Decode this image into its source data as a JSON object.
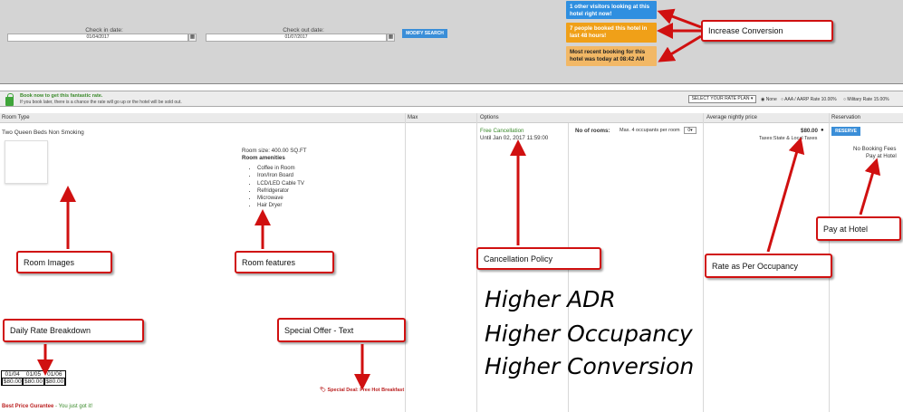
{
  "search": {
    "checkin_label": "Check in date:",
    "checkin_value": "01/04/2017",
    "checkout_label": "Check out date:",
    "checkout_value": "01/07/2017",
    "calendar_icon": "calendar-icon",
    "modify_label": "MODIFY SEARCH"
  },
  "notices": {
    "visitors": "1 other visitors looking at this hotel right now!",
    "booked": "7 people booked this hotel in last 48 hours!",
    "recent": "Most recent booking for this hotel was today at 08:42 AM"
  },
  "promo": {
    "title": "Book now to get this fantastic rate.",
    "subtitle": "If you book later, there is a chance the rate will go up or the hotel will be sold out.",
    "rate_plan_label": "SELECT YOUR RATE PLAN",
    "option_none": "None",
    "option_aaa": "AAA / AARP Rate 10.00%",
    "option_military": "Military Rate 15.00%"
  },
  "table": {
    "headers": {
      "room_type": "Room Type",
      "max": "Max",
      "options": "Options",
      "avg_price": "Average nightly price",
      "reservation": "Reservation"
    },
    "room": {
      "name": "Two Queen Beds Non Smoking",
      "size": "Room size: 400.00 SQ.FT",
      "amenities_title": "Room amenities",
      "amenities": [
        "Coffee in Room",
        "Iron/Iron Board",
        "LCD/LED Cable TV",
        "Refridgerator",
        "Microwave",
        "Hair Dryer"
      ],
      "cancel_title": "Free Cancellation",
      "cancel_until": "Until Jan 02, 2017 11:59:00",
      "rooms_label": "No of rooms:",
      "occupancy": "Max. 4 occupants per room",
      "rooms_select": "0",
      "price": "$80.00",
      "taxes": "Taxes:State & Local Taxes",
      "reserve_label": "RESERVE",
      "no_fees": "No Booking Fees",
      "pay_hotel": "Pay at Hotel",
      "special_deal": "Special Deal: Free Hot Breakfast",
      "rate_dates": [
        "01/04",
        "01/05",
        "01/06"
      ],
      "rate_values": [
        "$80.00",
        "$80.00",
        "$80.00"
      ],
      "best_price": "Best Price Gurantee",
      "best_price_suffix": " - You just got it!"
    }
  },
  "callouts": {
    "increase_conversion": "Increase Conversion",
    "room_images": "Room Images",
    "room_features": "Room features",
    "cancellation_policy": "Cancellation Policy",
    "rate_per_occupancy": "Rate as Per Occupancy",
    "pay_at_hotel": "Pay at Hotel",
    "daily_rate": "Daily Rate Breakdown",
    "special_offer": "Special Offer - Text"
  },
  "headlines": [
    "Higher ADR",
    "Higher Occupancy",
    "Higher Conversion"
  ],
  "colors": {
    "notice_blue": "#2f8fe0",
    "notice_orange": "#f0a018",
    "notice_tan": "#f2b866",
    "callout_red": "#d01010",
    "accent_blue": "#3a8ed8"
  }
}
